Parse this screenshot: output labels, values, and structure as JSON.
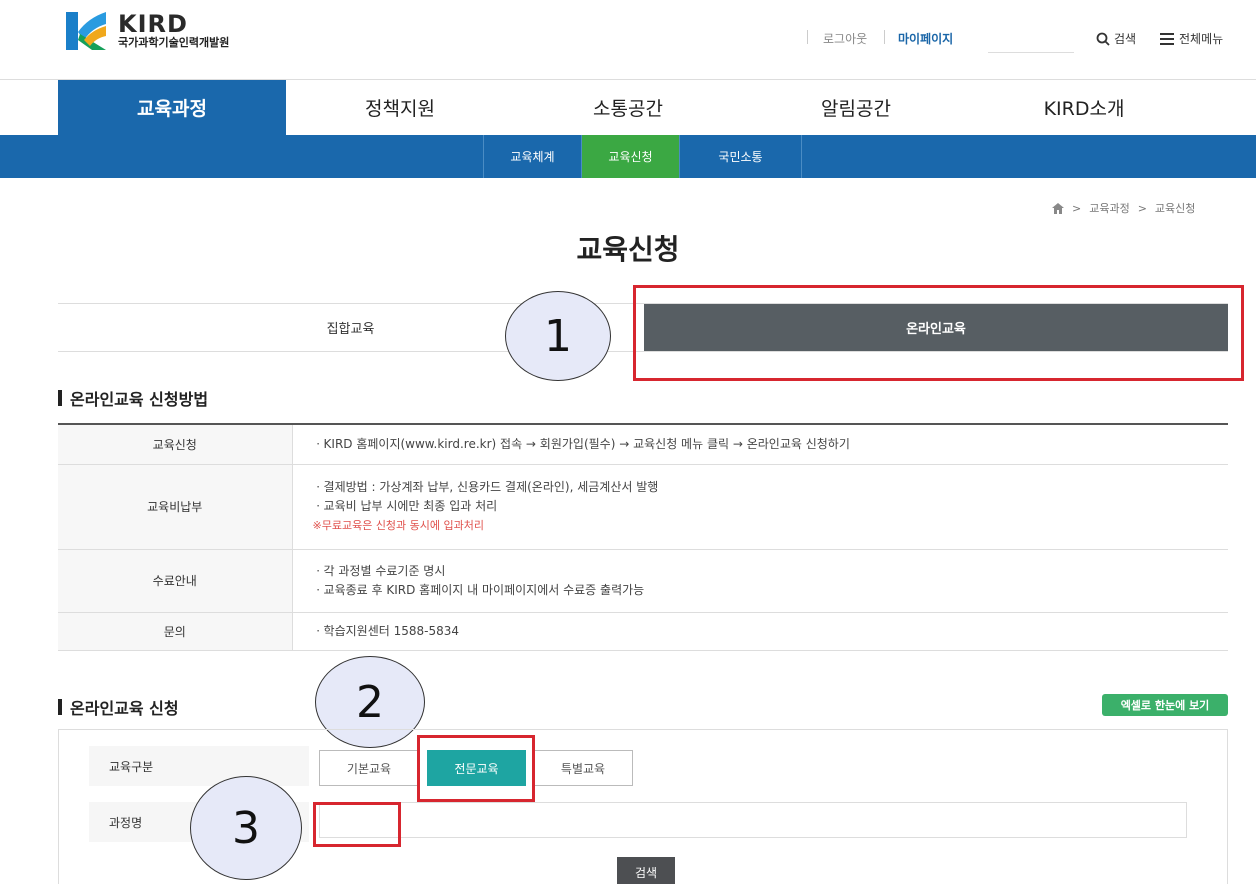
{
  "header": {
    "logo_title": "KIRD",
    "logo_subtitle": "국가과학기술인력개발원",
    "util": {
      "logout": "로그아웃",
      "mypage": "마이페이지"
    },
    "search_label": "검색",
    "menu_label": "전체메뉴"
  },
  "gnb": [
    "교육과정",
    "정책지원",
    "소통공간",
    "알림공간",
    "KIRD소개"
  ],
  "subnav": [
    "교육체계",
    "교육신청",
    "국민소통"
  ],
  "breadcrumb": [
    "교육과정",
    "교육신청"
  ],
  "page_title": "교육신청",
  "tabs": {
    "offline": "집합교육",
    "online": "온라인교육"
  },
  "annotations": [
    "1",
    "2",
    "3"
  ],
  "method": {
    "title": "온라인교육 신청방법",
    "rows": [
      {
        "label": "교육신청",
        "lines": [
          "ㆍKIRD 홈페이지(www.kird.re.kr) 접속 → 회원가입(필수) → 교육신청 메뉴 클릭 → 온라인교육 신청하기"
        ]
      },
      {
        "label": "교육비납부",
        "lines": [
          "ㆍ결제방법 : 가상계좌 납부, 신용카드 결제(온라인), 세금계산서 발행",
          "ㆍ교육비 납부 시에만 최종 입과 처리"
        ],
        "note": "※무료교육은 신청과 동시에 입과처리"
      },
      {
        "label": "수료안내",
        "lines": [
          "ㆍ각 과정별 수료기준 명시",
          "ㆍ교육종료 후 KIRD 홈페이지 내 마이페이지에서 수료증 출력가능"
        ]
      },
      {
        "label": "문의",
        "lines": [
          "ㆍ학습지원센터 1588-5834"
        ]
      }
    ]
  },
  "apply": {
    "title": "온라인교육 신청",
    "excel_button": "엑셀로 한눈에 보기",
    "category_label": "교육구분",
    "categories": [
      "기본교육",
      "전문교육",
      "특별교육"
    ],
    "course_label": "과정명",
    "course_value": "",
    "search_button": "검색"
  },
  "colors": {
    "primary": "#1a68ac",
    "active_sub": "#3ba843",
    "teal": "#1ea5a2",
    "highlight": "#d7262f"
  }
}
